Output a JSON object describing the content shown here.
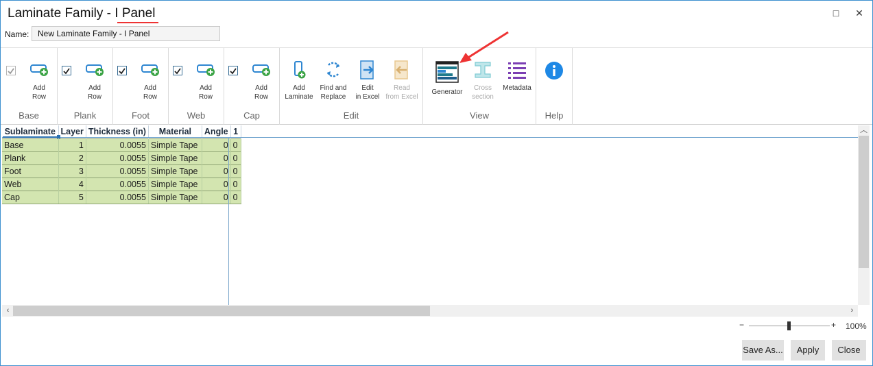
{
  "window": {
    "title_prefix": "Laminate Family - ",
    "title_suffix": "I Panel",
    "maximize_glyph": "□",
    "close_glyph": "✕"
  },
  "name_field": {
    "label": "Name:",
    "value": "New Laminate Family - I Panel"
  },
  "ribbon": {
    "groups": {
      "base": "Base",
      "plank": "Plank",
      "foot": "Foot",
      "web": "Web",
      "cap": "Cap",
      "edit": "Edit",
      "view": "View",
      "help": "Help"
    },
    "add_row": "Add\nRow",
    "add_laminate": "Add\nLaminate",
    "find_replace": "Find and\nReplace",
    "edit_excel": "Edit\nin Excel",
    "read_excel": "Read\nfrom Excel",
    "generator": "Generator",
    "cross_section": "Cross\nsection",
    "metadata": "Metadata"
  },
  "grid": {
    "columns": [
      "Sublaminate",
      "Layer",
      "Thickness (in)",
      "Material",
      "Angle",
      "1"
    ],
    "rows": [
      [
        "Base",
        "1",
        "0.0055",
        "Simple Tape",
        "0",
        "0"
      ],
      [
        "Plank",
        "2",
        "0.0055",
        "Simple Tape",
        "0",
        "0"
      ],
      [
        "Foot",
        "3",
        "0.0055",
        "Simple Tape",
        "0",
        "0"
      ],
      [
        "Web",
        "4",
        "0.0055",
        "Simple Tape",
        "0",
        "0"
      ],
      [
        "Cap",
        "5",
        "0.0055",
        "Simple Tape",
        "0",
        "0"
      ]
    ]
  },
  "zoom": {
    "minus": "−",
    "plus": "+",
    "value": "100%"
  },
  "footer": {
    "save_as": "Save As...",
    "apply": "Apply",
    "close": "Close"
  },
  "colors": {
    "accent": "#3c8fcf",
    "row_fill": "#d3e5b0",
    "annotation": "#e33"
  }
}
